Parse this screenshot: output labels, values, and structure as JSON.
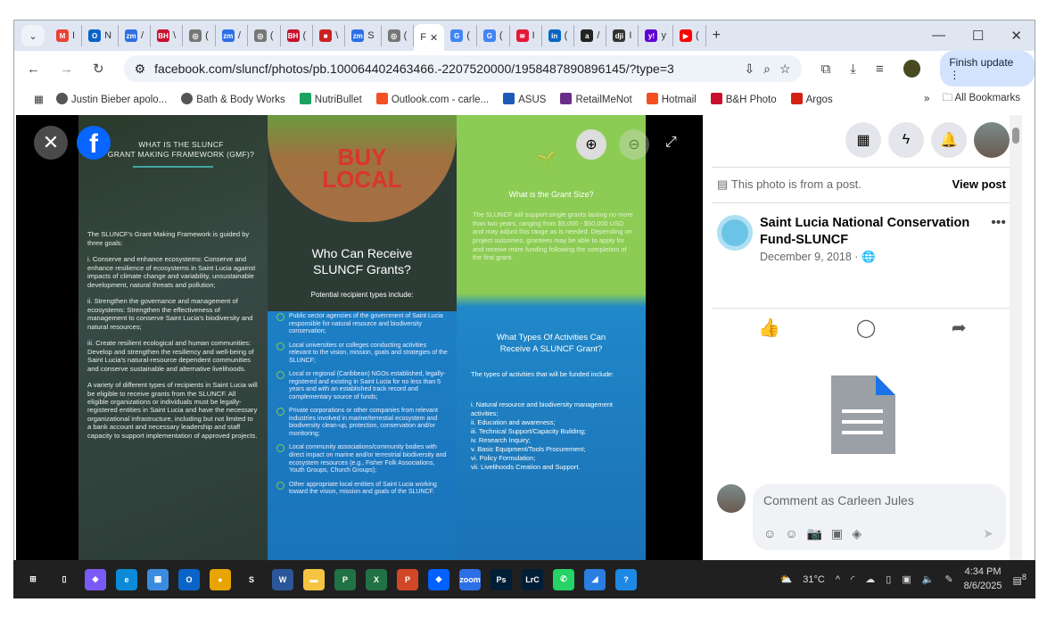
{
  "browser": {
    "tabs": [
      {
        "icon": "gmail-icon",
        "label": "M",
        "text": "I",
        "color": "#ea4335"
      },
      {
        "icon": "outlook-icon",
        "label": "O",
        "text": "N",
        "color": "#0a64c8"
      },
      {
        "icon": "zoom-icon",
        "label": "zm",
        "text": "/",
        "color": "#2d6fe6"
      },
      {
        "icon": "bh-icon",
        "label": "BH",
        "text": "\\",
        "color": "#c8102e"
      },
      {
        "icon": "generic-icon",
        "label": "◎",
        "text": "(",
        "color": "#777"
      },
      {
        "icon": "zoom-icon",
        "label": "zm",
        "text": "/",
        "color": "#2d6fe6"
      },
      {
        "icon": "generic-icon",
        "label": "◎",
        "text": "(",
        "color": "#777"
      },
      {
        "icon": "bh-icon",
        "label": "BH",
        "text": "(",
        "color": "#c8102e"
      },
      {
        "icon": "news-icon",
        "label": "■",
        "text": "\\",
        "color": "#c22"
      },
      {
        "icon": "zoom-icon",
        "label": "zm",
        "text": "S",
        "color": "#2d6fe6"
      },
      {
        "icon": "generic-icon",
        "label": "◎",
        "text": "(",
        "color": "#777"
      }
    ],
    "active_tab": {
      "text": "F"
    },
    "tabs_right": [
      {
        "icon": "google-icon",
        "label": "G",
        "text": "(",
        "color": "#4285f4"
      },
      {
        "icon": "google-icon",
        "label": "G",
        "text": "(",
        "color": "#4285f4"
      },
      {
        "icon": "bank-icon",
        "label": "≋",
        "text": "I",
        "color": "#e31837"
      },
      {
        "icon": "linkedin-icon",
        "label": "in",
        "text": "(",
        "color": "#0a66c2"
      },
      {
        "icon": "amazon-icon",
        "label": "a",
        "text": "/",
        "color": "#222"
      },
      {
        "icon": "dji-icon",
        "label": "dji",
        "text": "I",
        "color": "#333"
      },
      {
        "icon": "yahoo-icon",
        "label": "y!",
        "text": "y",
        "color": "#6001d2"
      },
      {
        "icon": "youtube-icon",
        "label": "▶",
        "text": "(",
        "color": "#f00"
      }
    ],
    "new_tab": "+",
    "url": "facebook.com/sluncf/photos/pb.100064402463466.-2207520000/1958487890896145/?type=3",
    "finish_update": "Finish update",
    "bookmarks": [
      {
        "label": "Justin Bieber apolo...",
        "icon": "globe-icon",
        "color": "#555"
      },
      {
        "label": "Bath & Body Works",
        "icon": "globe-icon",
        "color": "#555"
      },
      {
        "label": "NutriBullet",
        "icon": "nutribullet-icon",
        "color": "#1aa260"
      },
      {
        "label": "Outlook.com - carle...",
        "icon": "microsoft-icon",
        "color": "#f25022"
      },
      {
        "label": "ASUS",
        "icon": "asus-icon",
        "color": "#1e5bb8"
      },
      {
        "label": "RetailMeNot",
        "icon": "retailmenot-icon",
        "color": "#6b2d8a"
      },
      {
        "label": "Hotmail",
        "icon": "microsoft-icon",
        "color": "#f25022"
      },
      {
        "label": "B&H Photo",
        "icon": "bh-icon",
        "color": "#c8102e"
      },
      {
        "label": "Argos",
        "icon": "argos-icon",
        "color": "#d42114"
      }
    ],
    "all_bookmarks": "All Bookmarks"
  },
  "brochure": {
    "col1": {
      "title1": "WHAT IS THE SLUNCF",
      "title2": "GRANT MAKING FRAMEWORK (GMF)?",
      "paras": [
        "The SLUNCF's Grant Making Framework is guided by three goals:",
        "i. Conserve and enhance ecosystems: Conserve and enhance resilience of ecosystems in Saint Lucia against impacts of climate change and variability, unsustainable development, natural threats and pollution;",
        "ii. Strengthen the governance and management of ecosystems: Strengthen the effectiveness of management to conserve Saint Lucia's biodiversity and natural resources;",
        "iii. Create resilient ecological and human communities: Develop and strengthen the resiliency and well-being of Saint Lucia's natural-resource dependent communities and conserve sustainable and alternative livelihoods.",
        "A variety of different types of recipients in Saint Lucia will be eligible to receive grants from the SLUNCF. All eligible organizations or individuals must be legally-registered entities in Saint Lucia and have the necessary organizational infrastructure, including but not limited to a bank account and necessary leadership and staff capacity to support implementation of approved projects."
      ]
    },
    "col2": {
      "sign1": "BUY",
      "sign2": "LOCAL",
      "title1": "Who Can Receive",
      "title2": "SLUNCF Grants?",
      "subtitle": "Potential recipient types include:",
      "items": [
        "Public sector agencies of the government of Saint Lucia responsible for natural resource and biodiversity conservation;",
        "Local universities or colleges conducting activities relevant to the vision, mission, goals and strategies of the SLUNCF;",
        "Local or regional (Caribbean) NGOs established, legally-registered and existing in Saint Lucia for no less than 5 years and with an established track record and complementary source of funds;",
        "Private corporations or other companies from relevant industries involved in marine/terrestial ecosystem and biodiversity clean-up, protection, conservation and/or monitoring;",
        "Local community associations/community bodies with direct impact on marine and/or terrestrial biodiversity and ecosystem resources (e.g., Fisher Folk Associations, Youth Groups, Church Groups);",
        "Other appropriate local entities of Saint Lucia working toward the vision, mission and goals of the SLUNCF."
      ]
    },
    "col3": {
      "grant_title": "What is the Grant Size?",
      "grant_text": "The SLUNCF will support single grants lasting no more than two years, ranging from $5,000 - $50,000 USD and may adjust this range as is needed. Depending on project outcomes, grantees may be able to apply for and receive more funding following the completion of the first grant.",
      "title1": "What Types Of Activities Can",
      "title2": "Receive A SLUNCF Grant?",
      "intro": "The types of activities that will be funded include:",
      "items": [
        "i.   Natural resource and biodiversity management activities;",
        "ii.  Education and awareness;",
        "iii. Technical Support/Capacity Building;",
        "iv. Research Inquiry;",
        "v.  Basic Equipment/Tools Procurement;",
        "vi. Policy Formulation;",
        "vii. Livelihoods Creation and Support."
      ]
    }
  },
  "panel": {
    "from_post": "This photo is from a post.",
    "view_post": "View post",
    "page_name": "Saint Lucia National Conservation Fund-SLUNCF",
    "date": "December 9, 2018 · ",
    "comment_placeholder": "Comment as Carleen Jules"
  },
  "taskbar": {
    "apps": [
      {
        "icon": "start-icon",
        "label": "⊞",
        "color": "transparent"
      },
      {
        "icon": "task-view-icon",
        "label": "▯",
        "color": "transparent"
      },
      {
        "icon": "copilot-icon",
        "label": "◆",
        "color": "#7a5af8"
      },
      {
        "icon": "edge-icon",
        "label": "e",
        "color": "#0c8ad8"
      },
      {
        "icon": "store-icon",
        "label": "▦",
        "color": "#3b8ce0"
      },
      {
        "icon": "outlook-icon",
        "label": "O",
        "color": "#0a64c8"
      },
      {
        "icon": "chrome-icon",
        "label": "●",
        "color": "#e8a400"
      },
      {
        "icon": "app-icon",
        "label": "S",
        "color": "transparent"
      },
      {
        "icon": "word-icon",
        "label": "W",
        "color": "#2b579a"
      },
      {
        "icon": "file-explorer-icon",
        "label": "▬",
        "color": "#f5c542"
      },
      {
        "icon": "project-icon",
        "label": "P",
        "color": "#217346"
      },
      {
        "icon": "excel-icon",
        "label": "X",
        "color": "#217346"
      },
      {
        "icon": "powerpoint-icon",
        "label": "P",
        "color": "#d24726"
      },
      {
        "icon": "dropbox-icon",
        "label": "◆",
        "color": "#0061fe"
      },
      {
        "icon": "zoom-icon",
        "label": "zoom",
        "color": "#2d6fe6"
      },
      {
        "icon": "photoshop-icon",
        "label": "Ps",
        "color": "#001e36"
      },
      {
        "icon": "lightroom-icon",
        "label": "LrC",
        "color": "#001e36"
      },
      {
        "icon": "whatsapp-icon",
        "label": "✆",
        "color": "#25d366"
      },
      {
        "icon": "photos-icon",
        "label": "◢",
        "color": "#2a7de1"
      },
      {
        "icon": "help-icon",
        "label": "?",
        "color": "#1e88e5"
      }
    ],
    "weather": "31°C",
    "time": "4:34 PM",
    "date": "8/6/2025",
    "notifications": "8"
  }
}
